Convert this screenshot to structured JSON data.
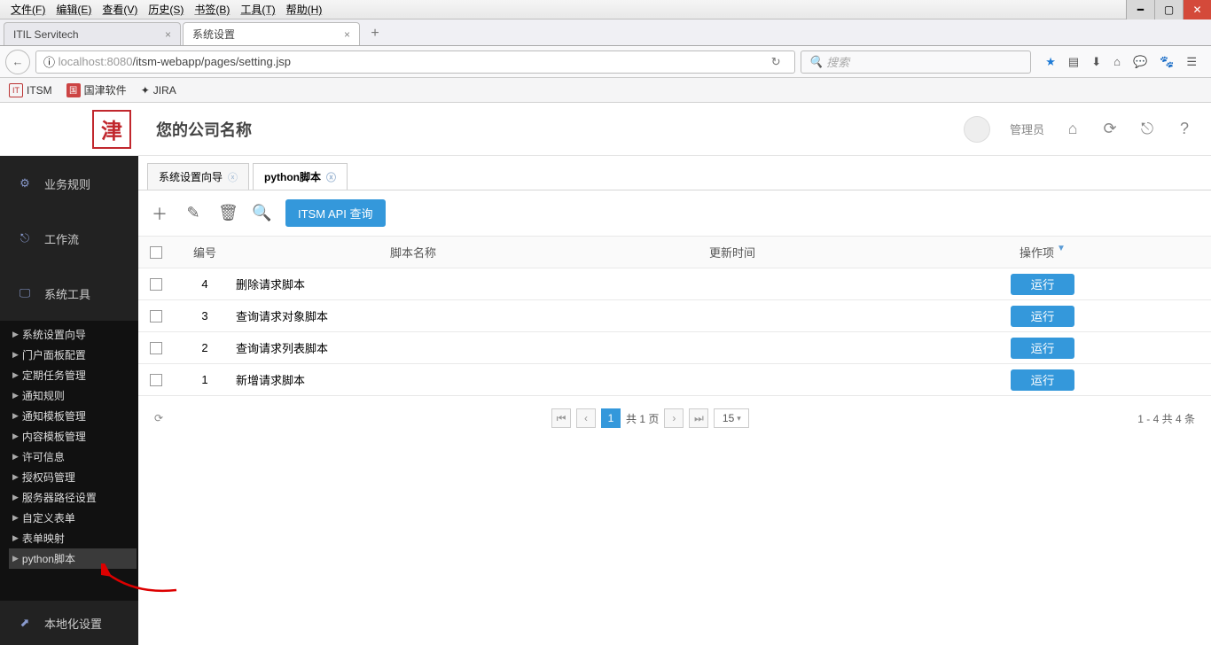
{
  "browser_menu": [
    "文件(F)",
    "编辑(E)",
    "查看(V)",
    "历史(S)",
    "书签(B)",
    "工具(T)",
    "帮助(H)"
  ],
  "browser_tabs": [
    {
      "title": "ITIL Servitech",
      "active": false
    },
    {
      "title": "系统设置",
      "active": true
    }
  ],
  "url": {
    "scheme": "ⓘ",
    "host": "localhost:8080",
    "path": "/itsm-webapp/pages/setting.jsp"
  },
  "search_placeholder": "搜索",
  "bookmarks": [
    {
      "label": "ITSM"
    },
    {
      "label": "国津软件"
    },
    {
      "label": "JIRA"
    }
  ],
  "header": {
    "company": "您的公司名称",
    "user": "管理员"
  },
  "sidebar": {
    "major": [
      {
        "label": "业务规则"
      },
      {
        "label": "工作流"
      },
      {
        "label": "系统工具"
      }
    ],
    "tree": [
      "系统设置向导",
      "门户面板配置",
      "定期任务管理",
      "通知规则",
      "通知模板管理",
      "内容模板管理",
      "许可信息",
      "授权码管理",
      "服务器路径设置",
      "自定义表单",
      "表单映射",
      "python脚本"
    ],
    "footer": "本地化设置"
  },
  "page_tabs": [
    {
      "label": "系统设置向导",
      "active": false
    },
    {
      "label": "python脚本",
      "active": true
    }
  ],
  "actions": {
    "api_btn": "ITSM API 查询"
  },
  "grid": {
    "headers": {
      "id": "编号",
      "name": "脚本名称",
      "time": "更新时间",
      "op": "操作项"
    },
    "rows": [
      {
        "id": "4",
        "name": "删除请求脚本",
        "op": "运行"
      },
      {
        "id": "3",
        "name": "查询请求对象脚本",
        "op": "运行"
      },
      {
        "id": "2",
        "name": "查询请求列表脚本",
        "op": "运行"
      },
      {
        "id": "1",
        "name": "新增请求脚本",
        "op": "运行"
      }
    ]
  },
  "pager": {
    "page": "1",
    "total_pages": "共 1 页",
    "size": "15",
    "summary": "1 - 4  共 4 条"
  }
}
